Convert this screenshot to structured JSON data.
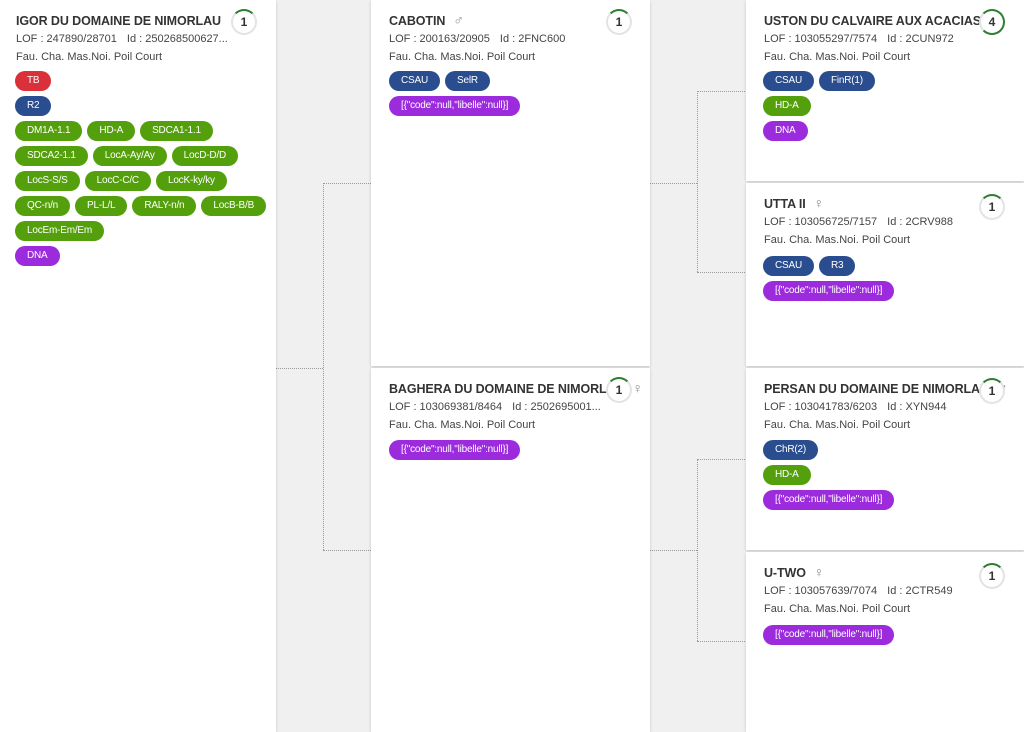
{
  "colors": {
    "red": "#d9303a",
    "blue": "#2a4d8f",
    "green": "#54a00c",
    "purple": "#9b2bdc",
    "ring": "#2e7d32"
  },
  "cards": {
    "igor": {
      "name": "IGOR DU DOMAINE DE NIMORLAU",
      "sex": "♂",
      "lof": "LOF : 247890/28701",
      "id": "Id : 250268500627...",
      "desc": "Fau. Cha. Mas.Noi. Poil Court",
      "count": "1",
      "badges": {
        "tb": "TB",
        "r2": "R2",
        "dm1a": "DM1A-1.1",
        "hda": "HD-A",
        "sdca1": "SDCA1-1.1",
        "sdca2": "SDCA2-1.1",
        "loca": "LocA-Ay/Ay",
        "locd": "LocD-D/D",
        "locs": "LocS-S/S",
        "locc": "LocC-C/C",
        "lock": "LocK-ky/ky",
        "qc": "QC-n/n",
        "pl": "PL-L/L",
        "raly": "RALY-n/n",
        "locb": "LocB-B/B",
        "locem": "LocEm-Em/Em",
        "dna": "DNA"
      }
    },
    "cabotin": {
      "name": "CABOTIN",
      "sex": "♂",
      "lof": "LOF : 200163/20905",
      "id": "Id : 2FNC600",
      "desc": "Fau. Cha. Mas.Noi. Poil Court",
      "count": "1",
      "badges": {
        "csau": "CSAU",
        "selr": "SelR",
        "json": "[{\"code\":null,\"libelle\":null}]"
      }
    },
    "baghera": {
      "name": "BAGHERA DU DOMAINE DE NIMORLAU",
      "sex": "♀",
      "lof": "LOF : 103069381/8464",
      "id": "Id : 2502695001...",
      "desc": "Fau. Cha. Mas.Noi. Poil Court",
      "count": "1",
      "badges": {
        "json": "[{\"code\":null,\"libelle\":null}]"
      }
    },
    "uston": {
      "name": "USTON DU CALVAIRE AUX ACACIAS",
      "sex": "♂",
      "lof": "LOF : 103055297/7574",
      "id": "Id : 2CUN972",
      "desc": "Fau. Cha. Mas.Noi. Poil Court",
      "count": "4",
      "badges": {
        "csau": "CSAU",
        "finr": "FinR(1)",
        "hda": "HD-A",
        "dna": "DNA"
      }
    },
    "utta": {
      "name": "UTTA II",
      "sex": "♀",
      "lof": "LOF : 103056725/7157",
      "id": "Id : 2CRV988",
      "desc": "Fau. Cha. Mas.Noi. Poil Court",
      "count": "1",
      "badges": {
        "csau": "CSAU",
        "r3": "R3",
        "json": "[{\"code\":null,\"libelle\":null}]"
      }
    },
    "persan": {
      "name": "PERSAN DU DOMAINE DE NIMORLAU",
      "sex": "♂",
      "lof": "LOF : 103041783/6203",
      "id": "Id : XYN944",
      "desc": "Fau. Cha. Mas.Noi. Poil Court",
      "count": "1",
      "badges": {
        "chr": "ChR(2)",
        "hda": "HD-A",
        "json": "[{\"code\":null,\"libelle\":null}]"
      }
    },
    "utwo": {
      "name": "U-TWO",
      "sex": "♀",
      "lof": "LOF : 103057639/7074",
      "id": "Id : 2CTR549",
      "desc": "Fau. Cha. Mas.Noi. Poil Court",
      "count": "1",
      "badges": {
        "json": "[{\"code\":null,\"libelle\":null}]"
      }
    }
  }
}
